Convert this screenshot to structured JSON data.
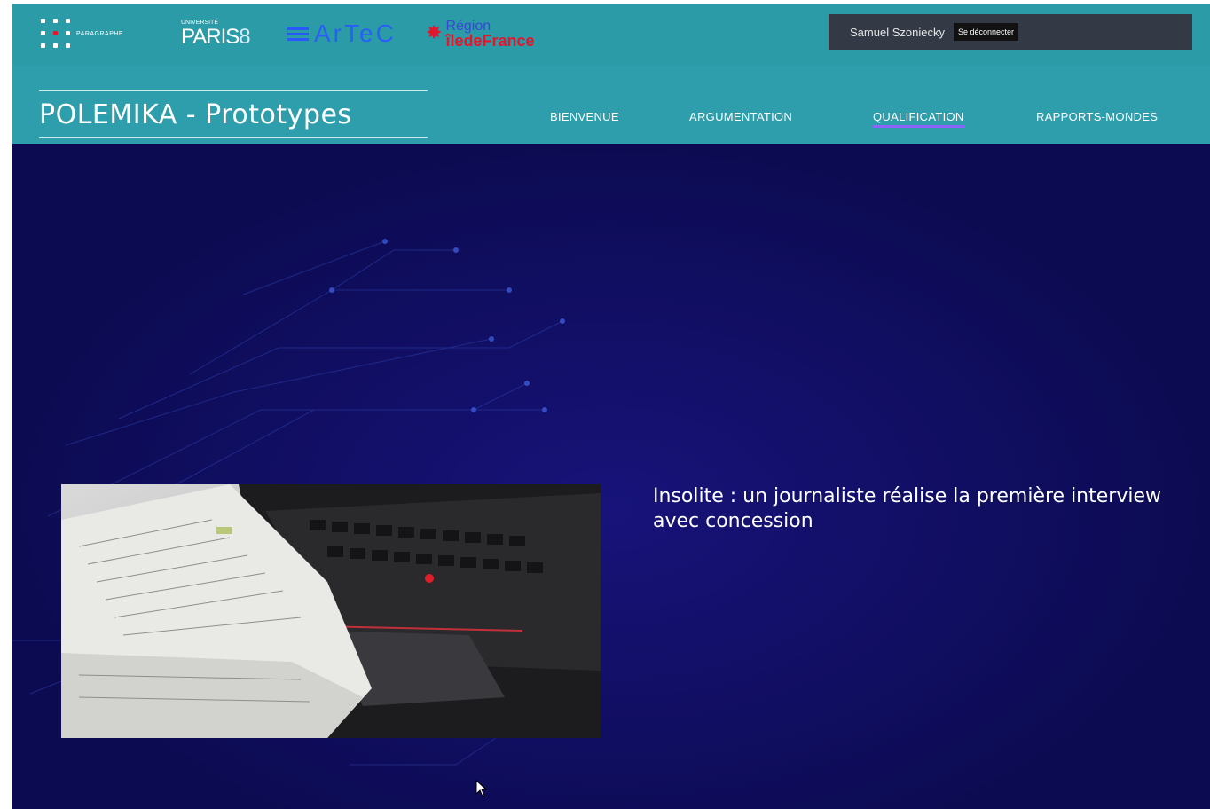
{
  "header": {
    "logos": {
      "paragraphe": "PARAGRAPHE",
      "paris8_small": "UNIVERSITÉ",
      "paris8_big": "PARIS",
      "paris8_num": "8",
      "artec": "ArTeC",
      "idf_line1": "Région",
      "idf_line2": "îledeFrance"
    },
    "user_name": "Samuel Szoniecky",
    "logout_label": "Se déconnecter"
  },
  "site_title": "POLEMIKA - Prototypes",
  "nav": [
    {
      "label": "BIENVENUE",
      "active": false
    },
    {
      "label": "ARGUMENTATION",
      "active": false
    },
    {
      "label": "QUALIFICATION",
      "active": true
    },
    {
      "label": "RAPPORTS-MONDES",
      "active": false
    }
  ],
  "article": {
    "headline": "Insolite : un journaliste réalise la première interview avec concession",
    "image_icon": "newspaper-on-laptop-photo"
  },
  "colors": {
    "header_bg": "#2b9ba8",
    "hero_bg": "#0c0b52",
    "user_bg": "#333a46",
    "active_underline": "#8f63ff"
  }
}
